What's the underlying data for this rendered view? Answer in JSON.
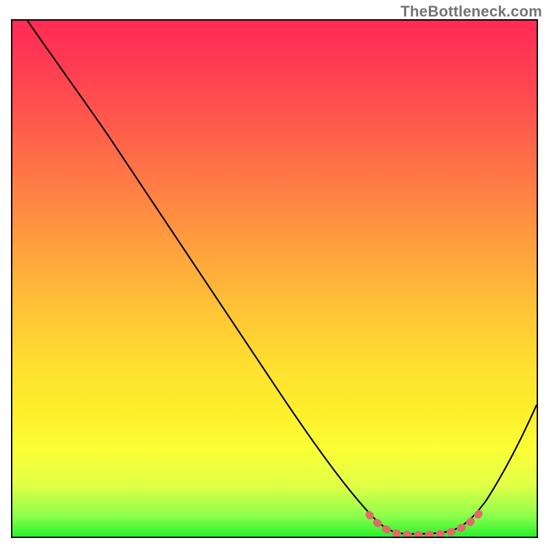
{
  "watermark": "TheBottleneck.com",
  "chart_data": {
    "type": "line",
    "title": "",
    "xlabel": "",
    "ylabel": "",
    "xlim": [
      0,
      100
    ],
    "ylim": [
      0,
      100
    ],
    "grid": false,
    "series": [
      {
        "name": "bottleneck-curve",
        "x": [
          3,
          10,
          18,
          25,
          32,
          40,
          48,
          55,
          62,
          67,
          70,
          73,
          76,
          79,
          82,
          85,
          88,
          92,
          96,
          100
        ],
        "y": [
          100,
          90,
          80,
          70,
          60,
          49,
          38,
          28,
          18,
          10,
          6,
          3,
          1,
          0,
          0,
          1,
          4,
          10,
          18,
          27
        ]
      }
    ],
    "optimal_zone": {
      "x_start": 69,
      "x_end": 90,
      "y": 0.8
    },
    "gradient_stops": [
      {
        "pct": 0,
        "color": "#ff2b55"
      },
      {
        "pct": 20,
        "color": "#ff5a4c"
      },
      {
        "pct": 45,
        "color": "#ffa33d"
      },
      {
        "pct": 68,
        "color": "#ffe22f"
      },
      {
        "pct": 90,
        "color": "#e2ff46"
      },
      {
        "pct": 100,
        "color": "#29f02e"
      }
    ]
  }
}
